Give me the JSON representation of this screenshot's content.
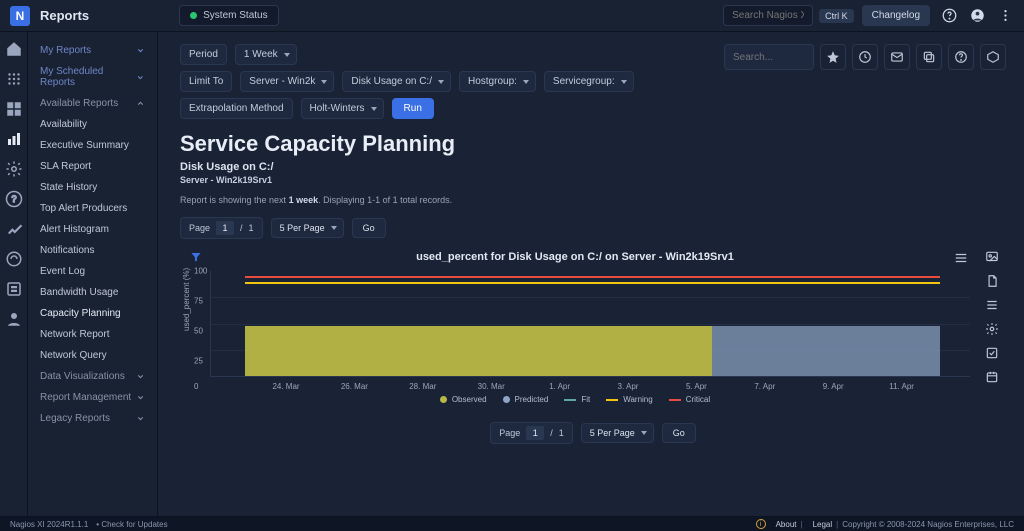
{
  "topbar": {
    "title": "Reports",
    "status_label": "System Status",
    "search_placeholder": "Search Nagios XI",
    "kbd": "Ctrl K",
    "changelog": "Changelog"
  },
  "sidebar": {
    "my_reports": "My Reports",
    "my_scheduled": "My Scheduled Reports",
    "available": "Available Reports",
    "items": [
      "Availability",
      "Executive Summary",
      "SLA Report",
      "State History",
      "Top Alert Producers",
      "Alert Histogram",
      "Notifications",
      "Event Log",
      "Bandwidth Usage",
      "Capacity Planning",
      "Network Report",
      "Network Query"
    ],
    "dataviz": "Data Visualizations",
    "report_mgmt": "Report Management",
    "legacy": "Legacy Reports"
  },
  "filters": {
    "period_label": "Period",
    "period_value": "1 Week",
    "limit_label": "Limit To",
    "server": "Server - Win2k",
    "disk": "Disk Usage on C:/",
    "hostgroup": "Hostgroup:",
    "servicegroup": "Servicegroup:",
    "extrap_label": "Extrapolation Method",
    "extrap_value": "Holt-Winters",
    "run": "Run",
    "search_placeholder": "Search..."
  },
  "page": {
    "title": "Service Capacity Planning",
    "sub1": "Disk Usage on C:/",
    "sub2": "Server - Win2k19Srv1",
    "desc_pre": "Report is showing the next ",
    "desc_bold": "1 week",
    "desc_post": ". Displaying 1-1 of 1 total records."
  },
  "pager": {
    "label": "Page",
    "current": "1",
    "sep": "/",
    "total": "1",
    "perpage": "5 Per Page",
    "go": "Go"
  },
  "chart": {
    "title": "used_percent for Disk Usage on C:/ on Server - Win2k19Srv1",
    "ylabel": "used_percent (%)",
    "legend": {
      "observed": "Observed",
      "predicted": "Predicted",
      "fit": "Fit",
      "warning": "Warning",
      "critical": "Critical"
    },
    "colors": {
      "observed": "#b9b847",
      "predicted": "#8fa5c6",
      "fit": "#5fa6a0",
      "warning": "#f1c40f",
      "critical": "#e74c3c"
    },
    "xticks": [
      "24. Mar",
      "26. Mar",
      "28. Mar",
      "30. Mar",
      "1. Apr",
      "3. Apr",
      "5. Apr",
      "7. Apr",
      "9. Apr",
      "11. Apr"
    ]
  },
  "chart_data": {
    "type": "area",
    "ylabel": "used_percent (%)",
    "ylim": [
      0,
      100
    ],
    "yticks": [
      0,
      25,
      50,
      75,
      100
    ],
    "x": [
      "24. Mar",
      "26. Mar",
      "28. Mar",
      "30. Mar",
      "1. Apr",
      "3. Apr",
      "5. Apr",
      "7. Apr",
      "9. Apr",
      "11. Apr"
    ],
    "series": [
      {
        "name": "Observed",
        "values": [
          48,
          48,
          48,
          48,
          48,
          48,
          48,
          null,
          null,
          null
        ]
      },
      {
        "name": "Predicted",
        "values": [
          null,
          null,
          null,
          null,
          null,
          null,
          48,
          48,
          48,
          48
        ]
      },
      {
        "name": "Fit",
        "values": [
          null,
          null,
          null,
          null,
          null,
          null,
          48,
          48,
          48,
          48
        ]
      },
      {
        "name": "Warning",
        "constant": 90
      },
      {
        "name": "Critical",
        "constant": 95
      }
    ]
  },
  "footer": {
    "version": "Nagios XI 2024R1.1.1",
    "check": "Check for Updates",
    "about": "About",
    "legal": "Legal",
    "copyright": "Copyright © 2008-2024 Nagios Enterprises, LLC"
  }
}
